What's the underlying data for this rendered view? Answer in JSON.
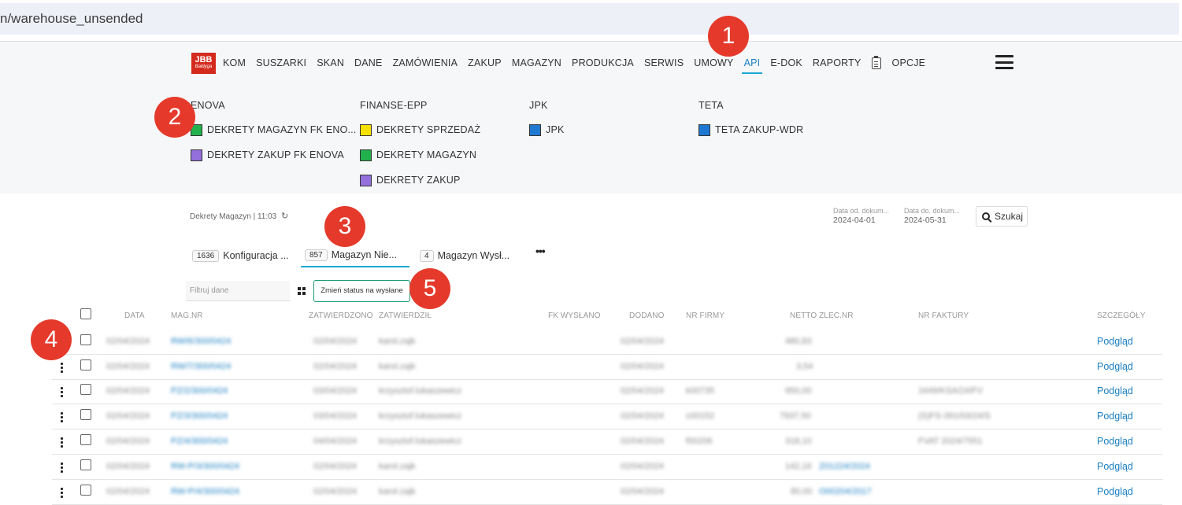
{
  "url": "n/warehouse_unsended",
  "logo": {
    "text": "JBB",
    "sub": "Bałdyga"
  },
  "nav": {
    "items": [
      "KOM",
      "SUSZARKI",
      "SKAN",
      "DANE",
      "ZAMÓWIENIA",
      "ZAKUP",
      "MAGAZYN",
      "PRODUKCJA",
      "SERWIS",
      "UMOWY",
      "API",
      "E-DOK",
      "RAPORTY"
    ],
    "after_icon": "OPCJE",
    "active": "API"
  },
  "badges": [
    "1",
    "2",
    "3",
    "4",
    "5"
  ],
  "submenu": {
    "enova": {
      "title": "ENOVA",
      "items": [
        {
          "label": "DEKRETY MAGAZYN FK ENO...",
          "color": "#22b14c"
        },
        {
          "label": "DEKRETY ZAKUP FK ENOVA",
          "color": "#9370db"
        }
      ]
    },
    "finanse": {
      "title": "FINANSE-EPP",
      "items": [
        {
          "label": "DEKRETY SPRZEDAŻ",
          "color": "#f5e000"
        },
        {
          "label": "DEKRETY MAGAZYN",
          "color": "#22b14c"
        },
        {
          "label": "DEKRETY ZAKUP",
          "color": "#9370db"
        }
      ]
    },
    "jpk": {
      "title": "JPK",
      "items": [
        {
          "label": "JPK",
          "color": "#1f78d1"
        }
      ]
    },
    "teta": {
      "title": "TETA",
      "items": [
        {
          "label": "TETA ZAKUP-WDR",
          "color": "#1f78d1"
        }
      ]
    }
  },
  "toolbar": {
    "breadcrumb": "Dekrety Magazyn | 11:03",
    "refresh_icon": "↻",
    "date_from_label": "Data od. dokum...",
    "date_from": "2024-04-01",
    "date_to_label": "Data do. dokum...",
    "date_to": "2024-05-31",
    "search_label": "Szukaj"
  },
  "tabs": [
    {
      "count": "1636",
      "label": "Konfiguracja ..."
    },
    {
      "count": "857",
      "label": "Magazyn Nie..."
    },
    {
      "count": "4",
      "label": "Magazyn Wysł..."
    }
  ],
  "more_tabs": "•••",
  "filter": {
    "placeholder": "Filtruj dane"
  },
  "status_button": "Zmień status na wysłane",
  "table": {
    "headers": [
      "DATA",
      "MAG.NR",
      "ZATWIERDZONO",
      "ZATWIERDZIŁ",
      "FK WYSŁANO",
      "DODANO",
      "NR FIRMY",
      "NETTO ZLEC.NR",
      "NR FAKTURY",
      "SZCZEGÓŁY"
    ],
    "rows": [
      {
        "data": "02/04/2024",
        "mag_nr": "RW/6/300/0424",
        "zatwierdzono": "02/04/2024",
        "zatwierdzil": "karol.zajk",
        "dodano": "02/04/2024",
        "nr_firmy": "",
        "netto": "480,83",
        "zlec": "",
        "faktura": "",
        "details": "Podgląd"
      },
      {
        "data": "02/04/2024",
        "mag_nr": "RW/7/300/0424",
        "zatwierdzono": "02/04/2024",
        "zatwierdzil": "karol.zajk",
        "dodano": "02/04/2024",
        "nr_firmy": "",
        "netto": "3,54",
        "zlec": "",
        "faktura": "",
        "details": "Podgląd"
      },
      {
        "data": "02/04/2024",
        "mag_nr": "PZ/2/300/0424",
        "zatwierdzono": "03/04/2024",
        "zatwierdzil": "krzysztof.lukaszewicz",
        "dodano": "02/04/2024",
        "nr_firmy": "k00735",
        "netto": "950,00",
        "zlec": "",
        "faktura": "1649/KSA/24/FV",
        "details": "Podgląd"
      },
      {
        "data": "02/04/2024",
        "mag_nr": "PZ/3/300/0424",
        "zatwierdzono": "03/04/2024",
        "zatwierdzil": "krzysztof.lukaszewicz",
        "dodano": "02/04/2024",
        "nr_firmy": "c00152",
        "netto": "7937,50",
        "zlec": "",
        "faktura": "(S)FS-391/03/24/S",
        "details": "Podgląd"
      },
      {
        "data": "02/04/2024",
        "mag_nr": "PZ/4/300/0424",
        "zatwierdzono": "04/04/2024",
        "zatwierdzil": "krzysztof.lukaszewicz",
        "dodano": "02/04/2024",
        "nr_firmy": "f00206",
        "netto": "318,10",
        "zlec": "",
        "faktura": "FVAT 2024/7551",
        "details": "Podgląd"
      },
      {
        "data": "02/04/2024",
        "mag_nr": "RW-P/3/300/0424",
        "zatwierdzono": "02/04/2024",
        "zatwierdzil": "karol.zajk",
        "dodano": "02/04/2024",
        "nr_firmy": "",
        "netto": "142,16",
        "zlec": "Z01224/2024",
        "faktura": "",
        "details": "Podgląd"
      },
      {
        "data": "02/04/2024",
        "mag_nr": "RW-P/4/300/0424",
        "zatwierdzono": "02/04/2024",
        "zatwierdzil": "karol.zajk",
        "dodano": "02/04/2024",
        "nr_firmy": "",
        "netto": "80,00",
        "zlec": "O00204/2017",
        "faktura": "",
        "details": "Podgląd"
      }
    ]
  },
  "colors": {
    "accent": "#1ea6d6",
    "link": "#1a7fc1",
    "badge": "#e53a2b",
    "status_border": "#1c9b77"
  }
}
